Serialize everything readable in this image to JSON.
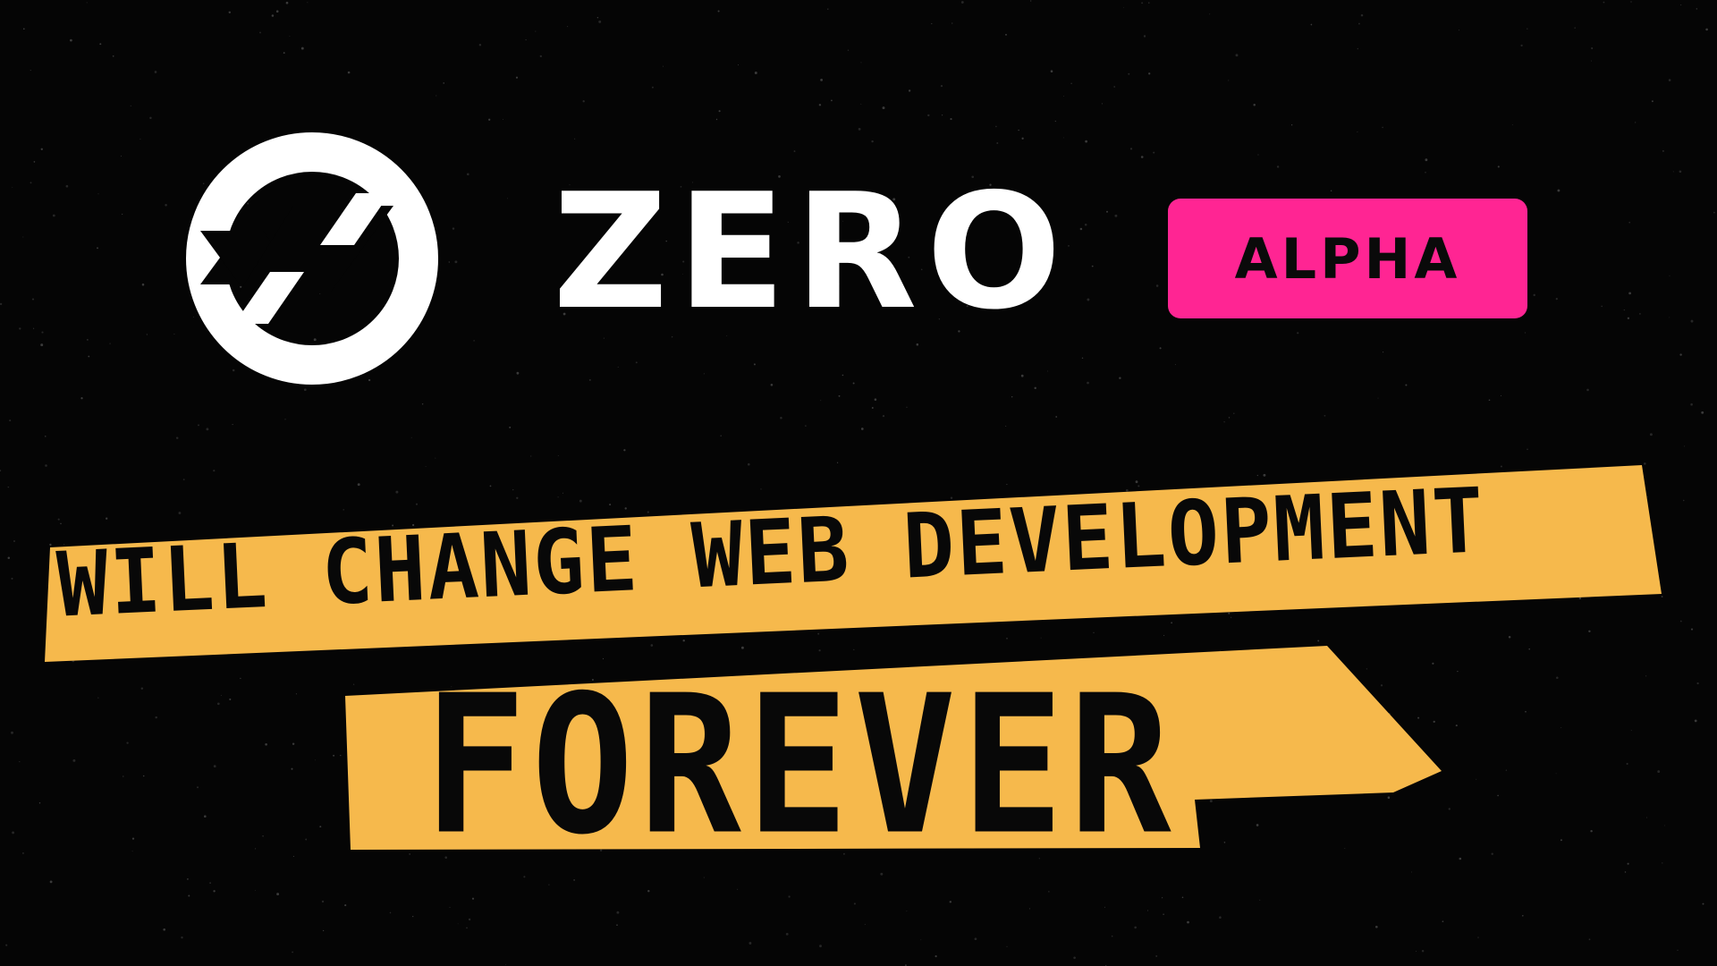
{
  "brand": {
    "name": "ZERO",
    "badge_label": "ALPHA",
    "logo_icon": "circular-arrows-icon"
  },
  "headline": {
    "line1": "WILL CHANGE WEB DEVELOPMENT",
    "line2": "FOREVER"
  },
  "colors": {
    "background": "#050505",
    "logo": "#ffffff",
    "badge": "#ff2593",
    "tape": "#f6b94c",
    "text_dark": "#080808"
  }
}
